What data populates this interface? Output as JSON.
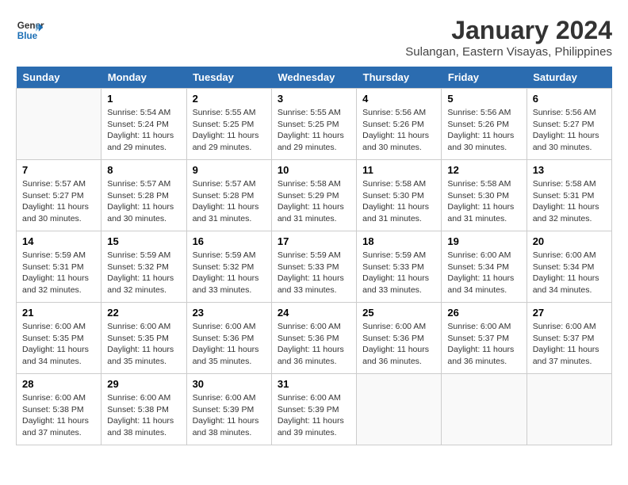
{
  "header": {
    "logo_line1": "General",
    "logo_line2": "Blue",
    "month": "January 2024",
    "location": "Sulangan, Eastern Visayas, Philippines"
  },
  "weekdays": [
    "Sunday",
    "Monday",
    "Tuesday",
    "Wednesday",
    "Thursday",
    "Friday",
    "Saturday"
  ],
  "weeks": [
    [
      {
        "day": "",
        "sunrise": "",
        "sunset": "",
        "daylight": ""
      },
      {
        "day": "1",
        "sunrise": "Sunrise: 5:54 AM",
        "sunset": "Sunset: 5:24 PM",
        "daylight": "Daylight: 11 hours and 29 minutes."
      },
      {
        "day": "2",
        "sunrise": "Sunrise: 5:55 AM",
        "sunset": "Sunset: 5:25 PM",
        "daylight": "Daylight: 11 hours and 29 minutes."
      },
      {
        "day": "3",
        "sunrise": "Sunrise: 5:55 AM",
        "sunset": "Sunset: 5:25 PM",
        "daylight": "Daylight: 11 hours and 29 minutes."
      },
      {
        "day": "4",
        "sunrise": "Sunrise: 5:56 AM",
        "sunset": "Sunset: 5:26 PM",
        "daylight": "Daylight: 11 hours and 30 minutes."
      },
      {
        "day": "5",
        "sunrise": "Sunrise: 5:56 AM",
        "sunset": "Sunset: 5:26 PM",
        "daylight": "Daylight: 11 hours and 30 minutes."
      },
      {
        "day": "6",
        "sunrise": "Sunrise: 5:56 AM",
        "sunset": "Sunset: 5:27 PM",
        "daylight": "Daylight: 11 hours and 30 minutes."
      }
    ],
    [
      {
        "day": "7",
        "sunrise": "Sunrise: 5:57 AM",
        "sunset": "Sunset: 5:27 PM",
        "daylight": "Daylight: 11 hours and 30 minutes."
      },
      {
        "day": "8",
        "sunrise": "Sunrise: 5:57 AM",
        "sunset": "Sunset: 5:28 PM",
        "daylight": "Daylight: 11 hours and 30 minutes."
      },
      {
        "day": "9",
        "sunrise": "Sunrise: 5:57 AM",
        "sunset": "Sunset: 5:28 PM",
        "daylight": "Daylight: 11 hours and 31 minutes."
      },
      {
        "day": "10",
        "sunrise": "Sunrise: 5:58 AM",
        "sunset": "Sunset: 5:29 PM",
        "daylight": "Daylight: 11 hours and 31 minutes."
      },
      {
        "day": "11",
        "sunrise": "Sunrise: 5:58 AM",
        "sunset": "Sunset: 5:30 PM",
        "daylight": "Daylight: 11 hours and 31 minutes."
      },
      {
        "day": "12",
        "sunrise": "Sunrise: 5:58 AM",
        "sunset": "Sunset: 5:30 PM",
        "daylight": "Daylight: 11 hours and 31 minutes."
      },
      {
        "day": "13",
        "sunrise": "Sunrise: 5:58 AM",
        "sunset": "Sunset: 5:31 PM",
        "daylight": "Daylight: 11 hours and 32 minutes."
      }
    ],
    [
      {
        "day": "14",
        "sunrise": "Sunrise: 5:59 AM",
        "sunset": "Sunset: 5:31 PM",
        "daylight": "Daylight: 11 hours and 32 minutes."
      },
      {
        "day": "15",
        "sunrise": "Sunrise: 5:59 AM",
        "sunset": "Sunset: 5:32 PM",
        "daylight": "Daylight: 11 hours and 32 minutes."
      },
      {
        "day": "16",
        "sunrise": "Sunrise: 5:59 AM",
        "sunset": "Sunset: 5:32 PM",
        "daylight": "Daylight: 11 hours and 33 minutes."
      },
      {
        "day": "17",
        "sunrise": "Sunrise: 5:59 AM",
        "sunset": "Sunset: 5:33 PM",
        "daylight": "Daylight: 11 hours and 33 minutes."
      },
      {
        "day": "18",
        "sunrise": "Sunrise: 5:59 AM",
        "sunset": "Sunset: 5:33 PM",
        "daylight": "Daylight: 11 hours and 33 minutes."
      },
      {
        "day": "19",
        "sunrise": "Sunrise: 6:00 AM",
        "sunset": "Sunset: 5:34 PM",
        "daylight": "Daylight: 11 hours and 34 minutes."
      },
      {
        "day": "20",
        "sunrise": "Sunrise: 6:00 AM",
        "sunset": "Sunset: 5:34 PM",
        "daylight": "Daylight: 11 hours and 34 minutes."
      }
    ],
    [
      {
        "day": "21",
        "sunrise": "Sunrise: 6:00 AM",
        "sunset": "Sunset: 5:35 PM",
        "daylight": "Daylight: 11 hours and 34 minutes."
      },
      {
        "day": "22",
        "sunrise": "Sunrise: 6:00 AM",
        "sunset": "Sunset: 5:35 PM",
        "daylight": "Daylight: 11 hours and 35 minutes."
      },
      {
        "day": "23",
        "sunrise": "Sunrise: 6:00 AM",
        "sunset": "Sunset: 5:36 PM",
        "daylight": "Daylight: 11 hours and 35 minutes."
      },
      {
        "day": "24",
        "sunrise": "Sunrise: 6:00 AM",
        "sunset": "Sunset: 5:36 PM",
        "daylight": "Daylight: 11 hours and 36 minutes."
      },
      {
        "day": "25",
        "sunrise": "Sunrise: 6:00 AM",
        "sunset": "Sunset: 5:36 PM",
        "daylight": "Daylight: 11 hours and 36 minutes."
      },
      {
        "day": "26",
        "sunrise": "Sunrise: 6:00 AM",
        "sunset": "Sunset: 5:37 PM",
        "daylight": "Daylight: 11 hours and 36 minutes."
      },
      {
        "day": "27",
        "sunrise": "Sunrise: 6:00 AM",
        "sunset": "Sunset: 5:37 PM",
        "daylight": "Daylight: 11 hours and 37 minutes."
      }
    ],
    [
      {
        "day": "28",
        "sunrise": "Sunrise: 6:00 AM",
        "sunset": "Sunset: 5:38 PM",
        "daylight": "Daylight: 11 hours and 37 minutes."
      },
      {
        "day": "29",
        "sunrise": "Sunrise: 6:00 AM",
        "sunset": "Sunset: 5:38 PM",
        "daylight": "Daylight: 11 hours and 38 minutes."
      },
      {
        "day": "30",
        "sunrise": "Sunrise: 6:00 AM",
        "sunset": "Sunset: 5:39 PM",
        "daylight": "Daylight: 11 hours and 38 minutes."
      },
      {
        "day": "31",
        "sunrise": "Sunrise: 6:00 AM",
        "sunset": "Sunset: 5:39 PM",
        "daylight": "Daylight: 11 hours and 39 minutes."
      },
      {
        "day": "",
        "sunrise": "",
        "sunset": "",
        "daylight": ""
      },
      {
        "day": "",
        "sunrise": "",
        "sunset": "",
        "daylight": ""
      },
      {
        "day": "",
        "sunrise": "",
        "sunset": "",
        "daylight": ""
      }
    ]
  ]
}
